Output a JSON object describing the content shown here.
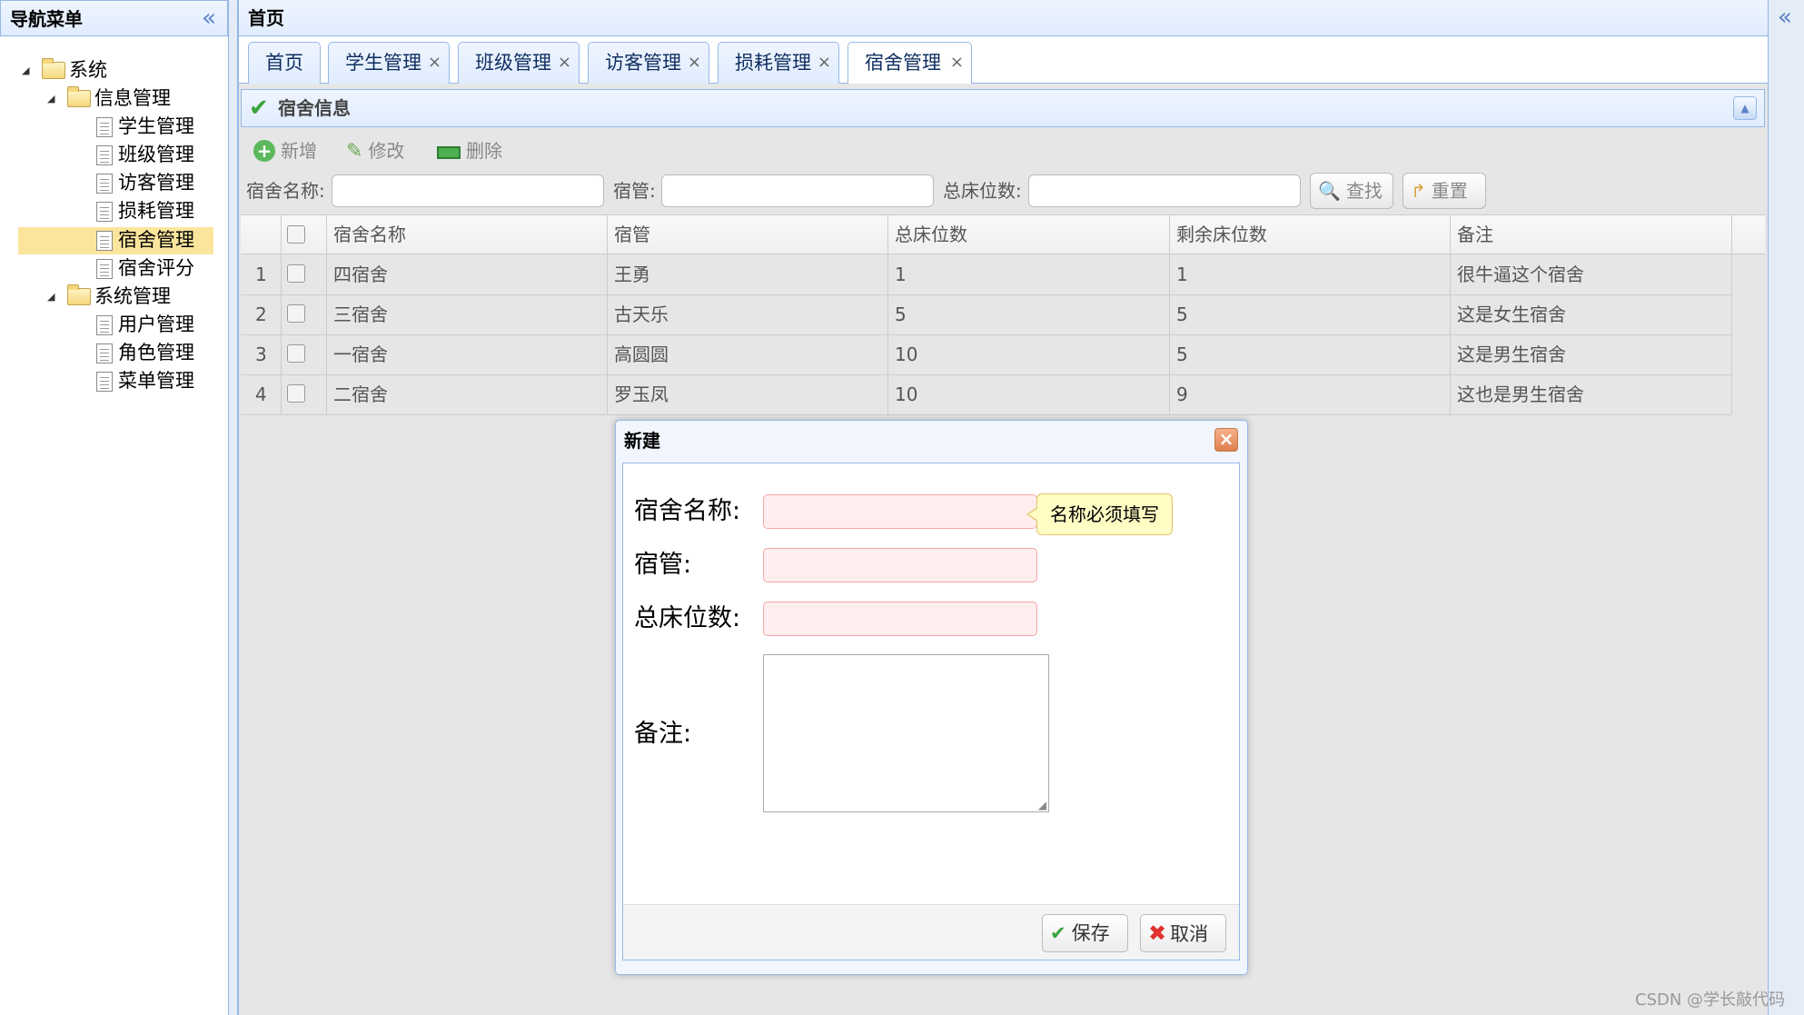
{
  "nav": {
    "title": "导航菜单",
    "collapse_icon": "«",
    "tree": {
      "root": "系统",
      "info_group": "信息管理",
      "info_items": [
        "学生管理",
        "班级管理",
        "访客管理",
        "损耗管理",
        "宿舍管理",
        "宿舍评分"
      ],
      "sys_group": "系统管理",
      "sys_items": [
        "用户管理",
        "角色管理",
        "菜单管理"
      ]
    }
  },
  "main": {
    "title": "首页",
    "collapse_icon": "«",
    "tabs": [
      "首页",
      "学生管理",
      "班级管理",
      "访客管理",
      "损耗管理",
      "宿舍管理"
    ],
    "tab_close": "×"
  },
  "panel": {
    "title": "宿舍信息",
    "toolbar": {
      "add": "新增",
      "edit": "修改",
      "delete": "删除"
    },
    "search": {
      "name_label": "宿舍名称:",
      "manager_label": "宿管:",
      "beds_label": "总床位数:",
      "find": "查找",
      "reset": "重置"
    }
  },
  "grid": {
    "columns": [
      "宿舍名称",
      "宿管",
      "总床位数",
      "剩余床位数",
      "备注"
    ],
    "rows": [
      {
        "no": "1",
        "name": "四宿舍",
        "manager": "王勇",
        "total": "1",
        "remain": "1",
        "note": "很牛逼这个宿舍"
      },
      {
        "no": "2",
        "name": "三宿舍",
        "manager": "古天乐",
        "total": "5",
        "remain": "5",
        "note": "这是女生宿舍"
      },
      {
        "no": "3",
        "name": "一宿舍",
        "manager": "高圆圆",
        "total": "10",
        "remain": "5",
        "note": "这是男生宿舍"
      },
      {
        "no": "4",
        "name": "二宿舍",
        "manager": "罗玉凤",
        "total": "10",
        "remain": "9",
        "note": "这也是男生宿舍"
      }
    ]
  },
  "dialog": {
    "title": "新建",
    "close": "×",
    "name_label": "宿舍名称:",
    "manager_label": "宿管:",
    "beds_label": "总床位数:",
    "note_label": "备注:",
    "tooltip": "名称必须填写",
    "save": "保存",
    "cancel": "取消"
  },
  "watermark": "CSDN @学长敲代码",
  "colors": {
    "border": "#95b8e7",
    "header": "#e0ecff",
    "selected": "#fbe59d",
    "invalid": "#ffeeee"
  }
}
